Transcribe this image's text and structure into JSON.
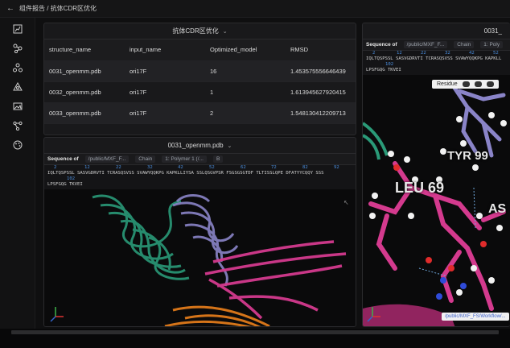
{
  "breadcrumb": "组件报告 / 抗体CDR区优化",
  "table_panel": {
    "title": "抗体CDR区优化",
    "columns": [
      "structure_name",
      "input_name",
      "Optimized_model",
      "RMSD"
    ],
    "rows": [
      [
        "0031_openmm.pdb",
        "ori17F",
        "16",
        "1.453575556646439"
      ],
      [
        "0032_openmm.pdb",
        "ori17F",
        "1",
        "1.613945627920415"
      ],
      [
        "0033_openmm.pdb",
        "ori17F",
        "2",
        "1.548130412209713"
      ]
    ]
  },
  "viewer_left": {
    "title": "0031_openmm.pdb",
    "seq_label": "Sequence of",
    "seq_path": "/public/MXF_F...",
    "seq_chain": "Chain",
    "seq_polymer": "1: Polymer 1 (/...",
    "seq_b": "B",
    "ruler_nums": [
      "2",
      "12",
      "22",
      "32",
      "42",
      "52",
      "62",
      "72",
      "82",
      "92"
    ],
    "seq_line1": "IQLTQSPSSL SASVGDRVTI TCRASQSVSS SVAWYQQKPG KAPKLLIYSA SSLQSGVPSR FSGSGSGTDF TLTISSLQPE DFATYYCQQY SSS",
    "ruler2": "102",
    "seq_line2": "LPSFGQG TKVEI"
  },
  "viewer_right": {
    "title": "0031_",
    "seq_label": "Sequence of",
    "seq_path": "/public/MXF_F...",
    "seq_chain": "Chain",
    "seq_polymer": "1: Poly",
    "ruler_nums": [
      "2",
      "12",
      "22",
      "32",
      "42",
      "52"
    ],
    "seq_line1": "IQLTQSPSSL SASVGDRVTI TCRASQSVSS SVAWYQQKPG KAPKLL",
    "ruler2": "102",
    "seq_line2": "LPSFGQG TKVEI",
    "residue_label": "Residue",
    "labels": [
      "TYR 99",
      "LEU 69",
      "AS"
    ],
    "path_chip": "/public/MXF_FS/Workflow/..."
  },
  "colors": {
    "green": "#2a9a78",
    "purple": "#8a84c8",
    "magenta": "#d43a8e",
    "orange": "#e07a1a"
  }
}
